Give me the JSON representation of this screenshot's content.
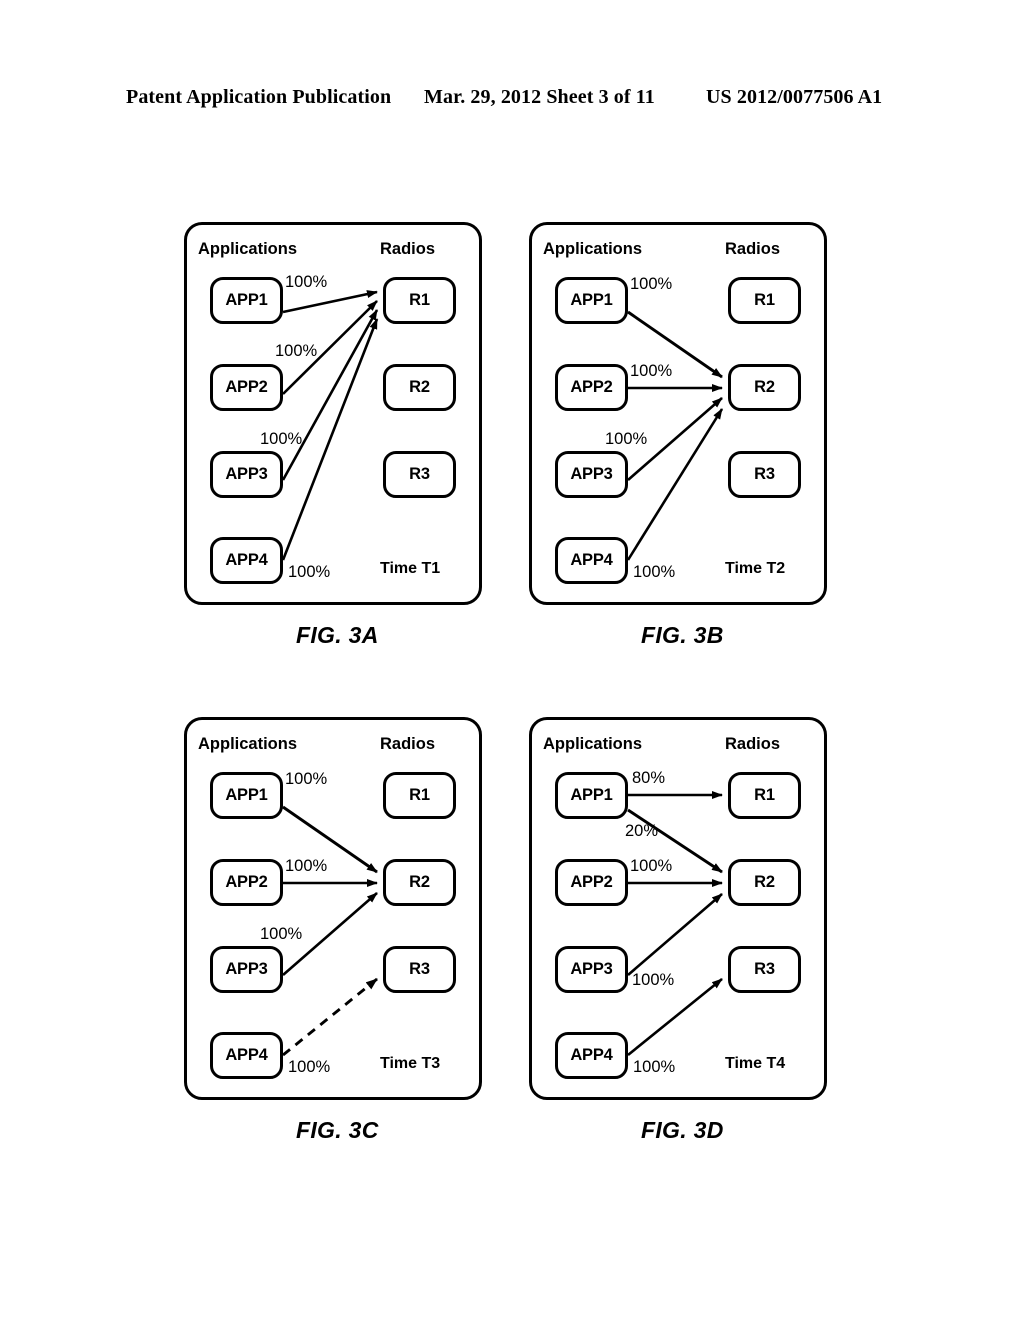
{
  "header": {
    "left": "Patent Application Publication",
    "middle": "Mar. 29, 2012  Sheet 3 of 11",
    "right": "US 2012/0077506 A1"
  },
  "common": {
    "applications_title": "Applications",
    "radios_title": "Radios",
    "app_labels": [
      "APP1",
      "APP2",
      "APP3",
      "APP4"
    ],
    "radio_labels": [
      "R1",
      "R2",
      "R3"
    ],
    "stroke_color": "#000000",
    "background_color": "#ffffff"
  },
  "figures": [
    {
      "id": "3A",
      "caption": "FIG. 3A",
      "time_label": "Time T1",
      "applications_title": "Applications",
      "radios_title": "Radios",
      "apps": [
        "APP1",
        "APP2",
        "APP3",
        "APP4"
      ],
      "radios": [
        "R1",
        "R2",
        "R3"
      ],
      "edges": [
        {
          "from": "APP1",
          "to": "R1",
          "percent": "100%",
          "style": "solid"
        },
        {
          "from": "APP2",
          "to": "R1",
          "percent": "100%",
          "style": "solid"
        },
        {
          "from": "APP3",
          "to": "R1",
          "percent": "100%",
          "style": "solid"
        },
        {
          "from": "APP4",
          "to": "R1",
          "percent": "100%",
          "style": "solid"
        }
      ],
      "labels": {
        "e1": "100%",
        "e2": "100%",
        "e3": "100%",
        "e4": "100%"
      }
    },
    {
      "id": "3B",
      "caption": "FIG. 3B",
      "time_label": "Time T2",
      "applications_title": "Applications",
      "radios_title": "Radios",
      "apps": [
        "APP1",
        "APP2",
        "APP3",
        "APP4"
      ],
      "radios": [
        "R1",
        "R2",
        "R3"
      ],
      "edges": [
        {
          "from": "APP1",
          "to": "R2",
          "percent": "100%",
          "style": "solid"
        },
        {
          "from": "APP2",
          "to": "R2",
          "percent": "100%",
          "style": "solid"
        },
        {
          "from": "APP3",
          "to": "R2",
          "percent": "100%",
          "style": "solid"
        },
        {
          "from": "APP4",
          "to": "R2",
          "percent": "100%",
          "style": "solid"
        }
      ],
      "labels": {
        "e1": "100%",
        "e2": "100%",
        "e3": "100%",
        "e4": "100%"
      }
    },
    {
      "id": "3C",
      "caption": "FIG. 3C",
      "time_label": "Time T3",
      "applications_title": "Applications",
      "radios_title": "Radios",
      "apps": [
        "APP1",
        "APP2",
        "APP3",
        "APP4"
      ],
      "radios": [
        "R1",
        "R2",
        "R3"
      ],
      "edges": [
        {
          "from": "APP1",
          "to": "R2",
          "percent": "100%",
          "style": "solid"
        },
        {
          "from": "APP2",
          "to": "R2",
          "percent": "100%",
          "style": "solid"
        },
        {
          "from": "APP3",
          "to": "R2",
          "percent": "100%",
          "style": "solid"
        },
        {
          "from": "APP4",
          "to": "R3",
          "percent": "100%",
          "style": "dashed"
        }
      ],
      "labels": {
        "e1": "100%",
        "e2": "100%",
        "e3": "100%",
        "e4": "100%"
      }
    },
    {
      "id": "3D",
      "caption": "FIG. 3D",
      "time_label": "Time T4",
      "applications_title": "Applications",
      "radios_title": "Radios",
      "apps": [
        "APP1",
        "APP2",
        "APP3",
        "APP4"
      ],
      "radios": [
        "R1",
        "R2",
        "R3"
      ],
      "edges": [
        {
          "from": "APP1",
          "to": "R1",
          "percent": "80%",
          "style": "solid"
        },
        {
          "from": "APP1",
          "to": "R2",
          "percent": "20%",
          "style": "solid"
        },
        {
          "from": "APP2",
          "to": "R2",
          "percent": "100%",
          "style": "solid"
        },
        {
          "from": "APP3",
          "to": "R2",
          "percent": "100%",
          "style": "solid"
        },
        {
          "from": "APP4",
          "to": "R3",
          "percent": "100%",
          "style": "solid"
        }
      ],
      "labels": {
        "e1": "80%",
        "e2": "20%",
        "e3": "100%",
        "e4": "100%",
        "e5": "100%"
      }
    }
  ]
}
